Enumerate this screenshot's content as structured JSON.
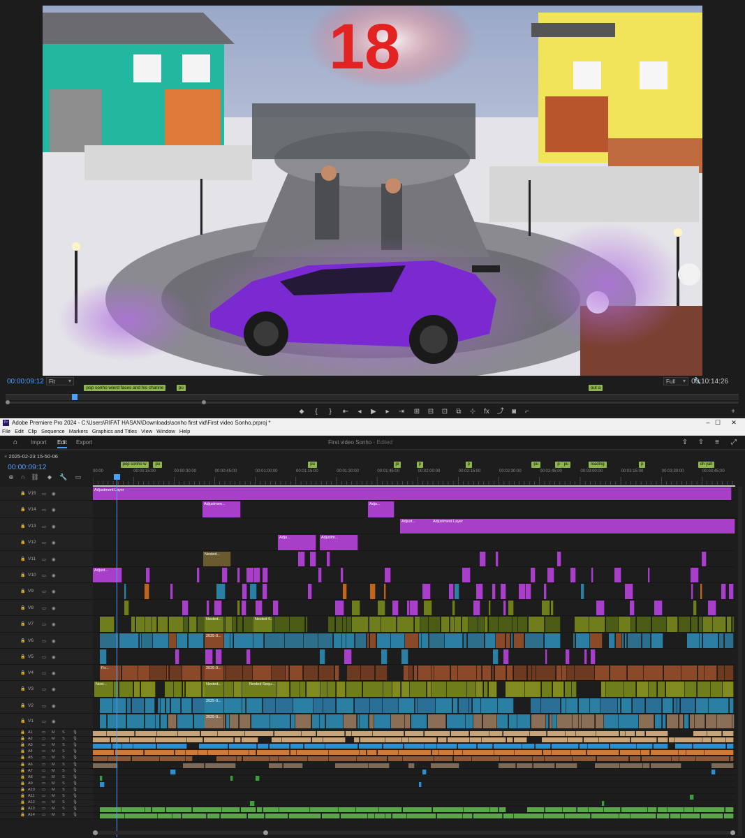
{
  "monitor": {
    "timecode": "00:00:09:12",
    "zoom": "Fit",
    "quality": "Full",
    "duration": "00:10:14:26",
    "playhead_fraction": 0.09,
    "overlay_number": "18",
    "markers": [
      {
        "label": "pop sonho wierd faces and his channe",
        "pos": 0.107
      },
      {
        "label": "pu",
        "pos": 0.233
      },
      {
        "label": "out a",
        "pos": 0.795
      }
    ],
    "transport_icons": [
      "add-marker-icon",
      "mark-in-icon",
      "mark-out-icon",
      "go-to-in-icon",
      "step-back-icon",
      "play-icon",
      "step-forward-icon",
      "go-to-out-icon",
      "insert-icon",
      "overwrite-icon",
      "lift-icon",
      "extract-icon",
      "trim-icon",
      "fx-icon",
      "export-frame-icon",
      "camera-icon",
      "comparison-icon",
      "plus-icon"
    ]
  },
  "app": {
    "title": "Adobe Premiere Pro 2024 - C:\\Users\\RIFAT HASAN\\Downloads\\sonho first vid\\First video Sonho.prproj *",
    "logo_text": "Pr",
    "menus": [
      "File",
      "Edit",
      "Clip",
      "Sequence",
      "Markers",
      "Graphics and Titles",
      "View",
      "Window",
      "Help"
    ],
    "window_controls": [
      "–",
      "☐",
      "✕"
    ],
    "tabs": {
      "import": "Import",
      "edit": "Edit",
      "export": "Export"
    },
    "project_name": "First video Sonho",
    "project_status": "- Edited"
  },
  "timeline": {
    "sequence_name": "2025-02-23 15-50-06",
    "timecode": "00:00:09:12",
    "ruler_labels": [
      "00:00",
      "00:00:15:00",
      "00:00:30:00",
      "00:00:45:00",
      "00:01:00:00",
      "00:01:15:00",
      "00:01:30:00",
      "00:01:45:00",
      "00:02:00:00",
      "00:02:15:00",
      "00:02:30:00",
      "00:02:45:00",
      "00:03:00:00",
      "00:03:15:00",
      "00:03:30:00",
      "00:03:45:00"
    ],
    "markers": [
      {
        "label": "pop sonho w",
        "pos": 0.043
      },
      {
        "label": "pu",
        "pos": 0.094
      },
      {
        "label": "pu",
        "pos": 0.335
      },
      {
        "label": "pi",
        "pos": 0.468
      },
      {
        "label": "p",
        "pos": 0.504
      },
      {
        "label": "p",
        "pos": 0.58
      },
      {
        "label": "p",
        "pos": 0.72
      },
      {
        "label": "pu",
        "pos": 0.683
      },
      {
        "label": "pu",
        "pos": 0.73
      },
      {
        "label": "loading",
        "pos": 0.772
      },
      {
        "label": "p",
        "pos": 0.85
      },
      {
        "label": "oh yall",
        "pos": 0.942
      }
    ],
    "video_tracks": [
      "V15",
      "V14",
      "V13",
      "V12",
      "V11",
      "V10",
      "V9",
      "V8",
      "V7",
      "V6",
      "V5",
      "V4",
      "V3",
      "V2",
      "V1"
    ],
    "audio_tracks": [
      "A1",
      "A2",
      "A3",
      "A4",
      "A5",
      "A6",
      "A7",
      "A8",
      "A9",
      "A10",
      "A11",
      "A12",
      "A13",
      "A14"
    ],
    "clip_labels": {
      "adjustment_layer": "Adjustment Layer",
      "adjustment_short": "Adjustmen...",
      "adju": "Adju...",
      "adjust": "Adjust...",
      "adjustm": "Adjustm...",
      "nested": "Nested...",
      "nested_s": "Nested S...",
      "nested_seq": "Nested Sequ...",
      "nest": "Nest...",
      "date_clip": "2025-0...",
      "fir": "Fir...",
      "fx": "fx"
    }
  },
  "colors": {
    "accent": "#4d9fff",
    "purple_clip": "#a83fc8",
    "green_clip": "#6f7d1c",
    "teal_clip": "#2a7fa3",
    "brown_clip": "#8a4a2a",
    "orange_clip": "#c0651d",
    "marker": "#8db64d"
  }
}
